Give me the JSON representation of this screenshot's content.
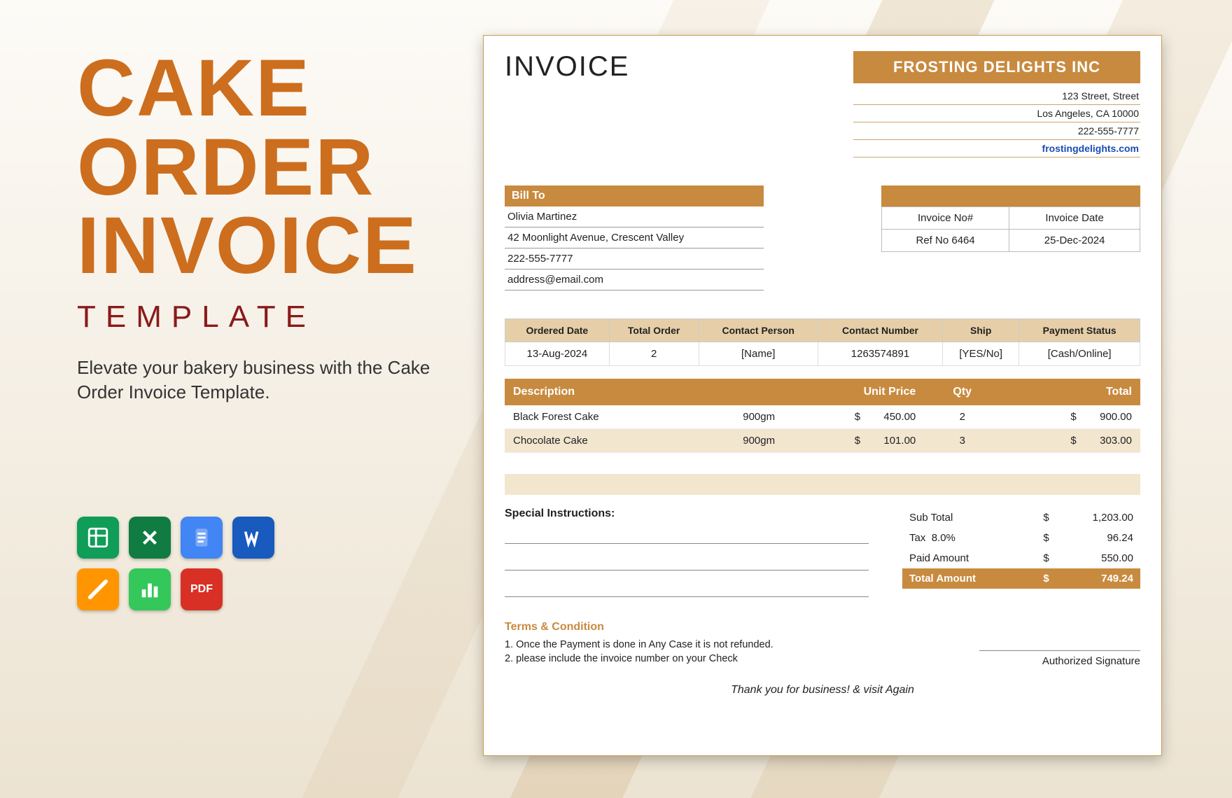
{
  "promo": {
    "headline1": "CAKE",
    "headline2": "ORDER",
    "headline3": "INVOICE",
    "subhead": "TEMPLATE",
    "tagline": "Elevate your bakery business with the Cake Order Invoice Template."
  },
  "formats": [
    {
      "name": "google-sheets-icon",
      "bg": "#0f9d58"
    },
    {
      "name": "excel-icon",
      "bg": "#107c41"
    },
    {
      "name": "google-docs-icon",
      "bg": "#4285f4"
    },
    {
      "name": "word-icon",
      "bg": "#185abd"
    },
    {
      "name": "pages-icon",
      "bg": "#ff9500"
    },
    {
      "name": "numbers-icon",
      "bg": "#34c759"
    },
    {
      "name": "pdf-icon",
      "bg": "#d93025",
      "label": "PDF"
    }
  ],
  "invoice": {
    "title": "INVOICE",
    "company": {
      "name": "FROSTING DELIGHTS INC",
      "street": "123 Street, Street",
      "city": "Los Angeles, CA 10000",
      "phone": "222-555-7777",
      "website": "frostingdelights.com"
    },
    "bill_to": {
      "label": "Bill To",
      "name": "Olivia Martinez",
      "address": "42 Moonlight Avenue, Crescent Valley",
      "phone": "222-555-7777",
      "email": "address@email.com"
    },
    "meta": {
      "no_label": "Invoice No#",
      "date_label": "Invoice Date",
      "ref": "Ref No 6464",
      "date": "25-Dec-2024"
    },
    "order_headers": [
      "Ordered Date",
      "Total Order",
      "Contact Person",
      "Contact Number",
      "Ship",
      "Payment Status"
    ],
    "order_row": [
      "13-Aug-2024",
      "2",
      "[Name]",
      "1263574891",
      "[YES/No]",
      "[Cash/Online]"
    ],
    "item_headers": {
      "desc": "Description",
      "unit": "Unit Price",
      "qty": "Qty",
      "total": "Total"
    },
    "items": [
      {
        "desc": "Black Forest Cake",
        "size": "900gm",
        "unit": "450.00",
        "qty": "2",
        "total": "900.00"
      },
      {
        "desc": "Chocolate Cake",
        "size": "900gm",
        "unit": "101.00",
        "qty": "3",
        "total": "303.00"
      }
    ],
    "special_label": "Special Instructions:",
    "totals": {
      "subtotal_label": "Sub Total",
      "subtotal": "1,203.00",
      "tax_label": "Tax",
      "tax_rate": "8.0%",
      "tax": "96.24",
      "paid_label": "Paid Amount",
      "paid": "550.00",
      "grand_label": "Total Amount",
      "grand": "749.24",
      "currency": "$"
    },
    "terms": {
      "title": "Terms & Condition",
      "lines": [
        "1. Once the Payment is done in Any Case it is not refunded.",
        "2. please include the invoice number on your Check"
      ]
    },
    "signature": "Authorized Signature",
    "thanks": "Thank you for business! & visit Again"
  }
}
